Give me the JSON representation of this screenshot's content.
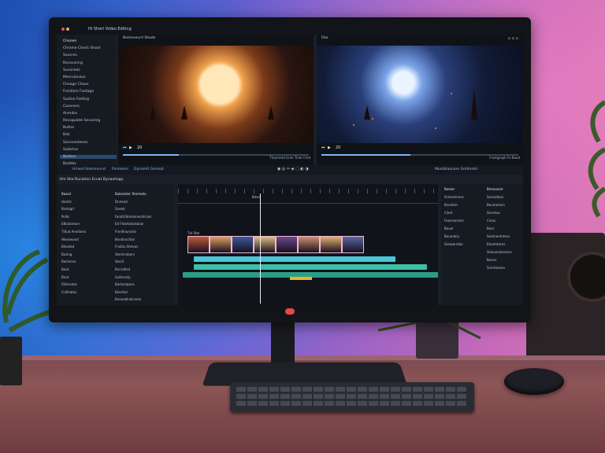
{
  "app": {
    "title": "Hi Short Video Editing"
  },
  "file_panel": {
    "header": "Chonen",
    "items": [
      "Chrome Check Shoot",
      "Sources",
      "Recocaring",
      "Sucaneas",
      "Merculanous",
      "Cheage Chous",
      "Frontiers Footage",
      "Sudine Feeling",
      "Coseners",
      "Anmdos",
      "Recogulate Secaning",
      "Buttss",
      "Bok",
      "Secnesetenes",
      "Sutertus",
      "Bedess",
      "Boddes"
    ],
    "selected_index": 15
  },
  "viewers": {
    "left": {
      "tab": "Bemoveurd Shade",
      "timecode_label": "Thomrstd Grim Tiner Fmd",
      "progress": 0.3,
      "counter": "20"
    },
    "right": {
      "tab": "Ebo",
      "timecode_label": "Frostgraph Fo Bood",
      "progress": 0.45,
      "counter": "20"
    }
  },
  "toolbar": {
    "label_a": "Hiraed Sotsmonnd",
    "label_b": "Pinmeors",
    "label_c": "Dynamit Gemsot",
    "right_label": "Muntdiaunare Gmtinntd"
  },
  "sequence_title": "Itm Sho-Runation Ecnat Dynaohogu",
  "bins": {
    "col_a_header": "Bassd",
    "col_a": [
      "Hentis",
      "Brotogd",
      "Pollis",
      "EBoalanwsr",
      "Tlitud Anvitions",
      "Hleoswood",
      "Bhasted",
      "Bosing",
      "Bacheres",
      "Beat",
      "Beat",
      "Sfohnates",
      "Fulhhates"
    ],
    "col_b_header": "Bubrenter Teinmoto",
    "col_b": [
      "Dnnead",
      "Sneeb",
      "Fandit Bommnoshhcles",
      "Ed Flowhatolsbow",
      "Frnrdlnunosts",
      "Bnodonchiar",
      "Fnoitiu Shevos",
      "Sleminnbers",
      "Secdl",
      "Bnrvdtisd",
      "Suthoraty",
      "Bactonlgnes",
      "Beerfod"
    ],
    "footer": "Bneeedlndcnans"
  },
  "timeline": {
    "marker": "Binsd",
    "clip_label": "Tnl Stm",
    "clips": 8
  },
  "inspector": {
    "header_a": "Bamer",
    "header_b": "Bmnanest",
    "items_a": [
      "Ssmontnens",
      "Brocbrm",
      "Cleot",
      "Foonsensinn",
      "Bouer",
      "Boundary",
      "Snewantdor"
    ],
    "items_b": [
      "Sonnotbns",
      "Beumomirs",
      "Sonntoo",
      "Cinos",
      "Boor",
      "Sontnentntens",
      "Etootntores",
      "Shwunnlanstors",
      "Beons",
      "Sinmtmonn"
    ]
  },
  "colors": {
    "accent": "#7fb4ff",
    "clip_border": "#f0b7d8",
    "track_teal": "#3dbfa6",
    "track_cyan": "#49c6d8"
  }
}
